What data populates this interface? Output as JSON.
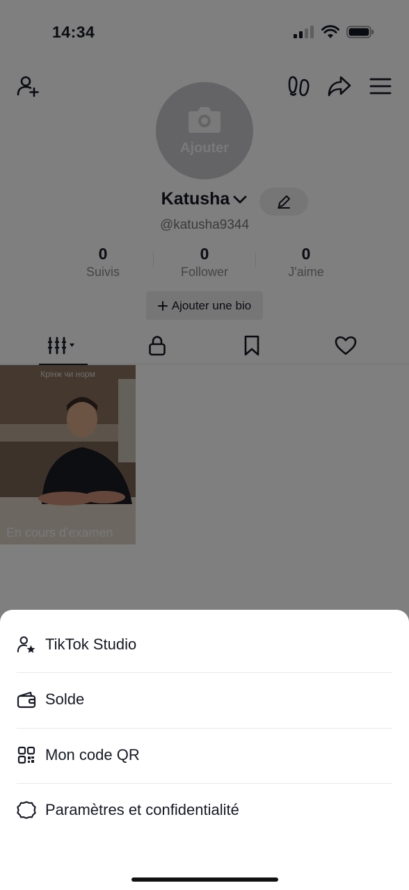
{
  "status_bar": {
    "time": "14:34"
  },
  "profile": {
    "avatar_label": "Ajouter",
    "display_name": "Katusha",
    "handle": "@katusha9344",
    "stats": [
      {
        "value": "0",
        "label": "Suivis"
      },
      {
        "value": "0",
        "label": "Follower"
      },
      {
        "value": "0",
        "label": "J'aime"
      }
    ],
    "bio_button": "Ajouter une bio"
  },
  "tabs": [
    "videos-grid-icon",
    "lock-icon",
    "bookmark-icon",
    "heart-icon"
  ],
  "video": {
    "top_text": "Крінж чи норм",
    "status": "En cours d'examen"
  },
  "sheet": {
    "items": [
      {
        "label": "TikTok Studio",
        "icon": "person-star-icon"
      },
      {
        "label": "Solde",
        "icon": "wallet-icon"
      },
      {
        "label": "Mon code QR",
        "icon": "qr-code-icon"
      },
      {
        "label": "Paramètres et confidentialité",
        "icon": "gear-icon"
      }
    ]
  },
  "colors": {
    "overlay": "#000000",
    "text": "#161823",
    "muted": "#8a8b91"
  }
}
